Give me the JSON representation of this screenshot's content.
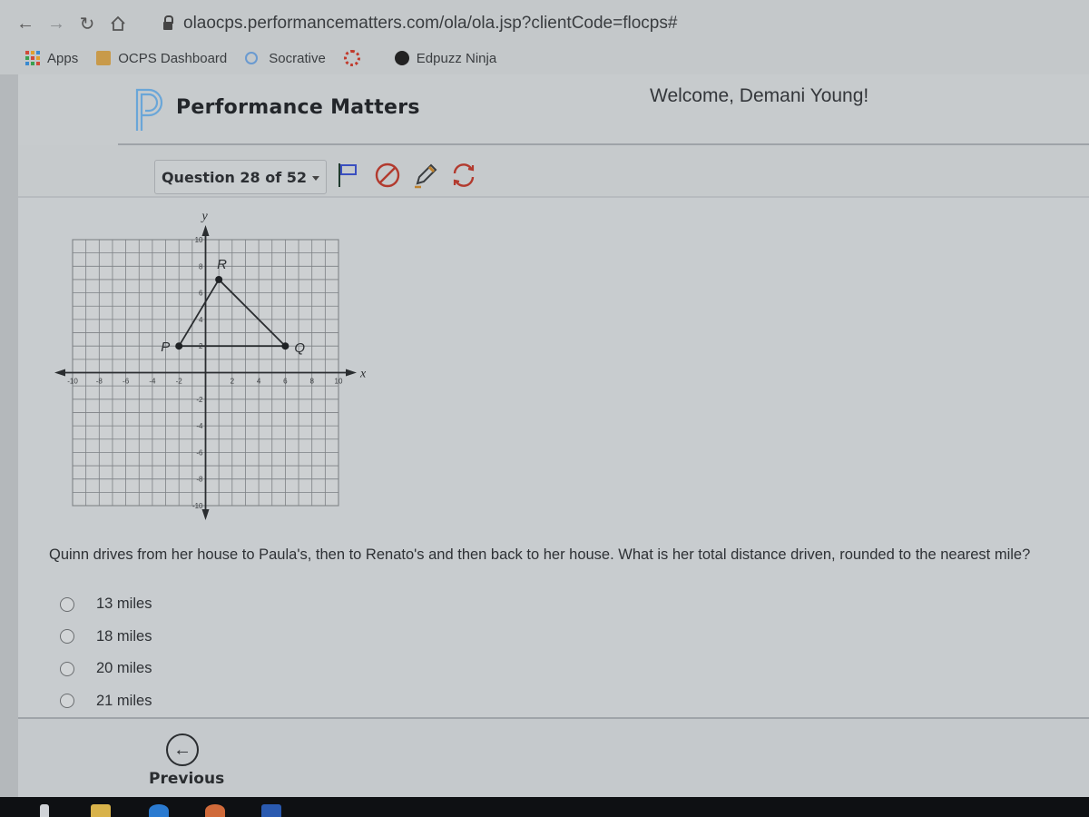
{
  "browser": {
    "nav": {
      "back_icon": "arrow-left-icon",
      "forward_icon": "arrow-right-icon",
      "reload_icon": "reload-icon",
      "home_icon": "home-icon"
    },
    "url": "olaocps.performancematters.com/ola/ola.jsp?clientCode=flocps#",
    "bookmarks": [
      {
        "label": "Apps",
        "icon": "apps-grid-icon"
      },
      {
        "label": "OCPS Dashboard",
        "icon": "ocps-icon"
      },
      {
        "label": "Socrative",
        "icon": "socrative-icon"
      },
      {
        "label": "",
        "icon": "bookmark-ring-icon"
      },
      {
        "label": "Edpuzz Ninja",
        "icon": "ninja-icon"
      }
    ]
  },
  "header": {
    "brand": "Performance Matters",
    "welcome": "Welcome, Demani Young!"
  },
  "toolbar": {
    "question_selector": "Question 28 of 52",
    "icons": [
      "flag-icon",
      "eliminate-icon",
      "pencil-icon",
      "refresh-icon"
    ],
    "colors": {
      "flag": "#3a4fc0",
      "eliminate": "#b23a2e",
      "pencil": "#c0832e",
      "refresh": "#b23a2e"
    }
  },
  "graph": {
    "x_label": "x",
    "y_label": "y",
    "range": [
      -10,
      10
    ],
    "x_ticks": [
      "-10",
      "-8",
      "-6",
      "-4",
      "-2",
      "2",
      "4",
      "6",
      "8",
      "10"
    ],
    "y_ticks": [
      "10",
      "8",
      "6",
      "4",
      "2",
      "-2",
      "-4",
      "-6",
      "-8",
      "-10"
    ],
    "tick_values": [
      -10,
      -8,
      -6,
      -4,
      -2,
      2,
      4,
      6,
      8,
      10
    ],
    "points": [
      {
        "label": "P",
        "x": -2,
        "y": 2
      },
      {
        "label": "R",
        "x": 1,
        "y": 7
      },
      {
        "label": "Q",
        "x": 6,
        "y": 2
      }
    ],
    "segments": [
      [
        "P",
        "R"
      ],
      [
        "R",
        "Q"
      ],
      [
        "Q",
        "P"
      ]
    ]
  },
  "question": {
    "text": "Quinn drives from her house to Paula's, then to Renato's and then back to her house. What is her total distance driven, rounded to the nearest mile?",
    "choices": [
      "13 miles",
      "18 miles",
      "20 miles",
      "21 miles"
    ]
  },
  "footer": {
    "previous_label": "Previous",
    "previous_icon": "arrow-left-circle-icon"
  }
}
